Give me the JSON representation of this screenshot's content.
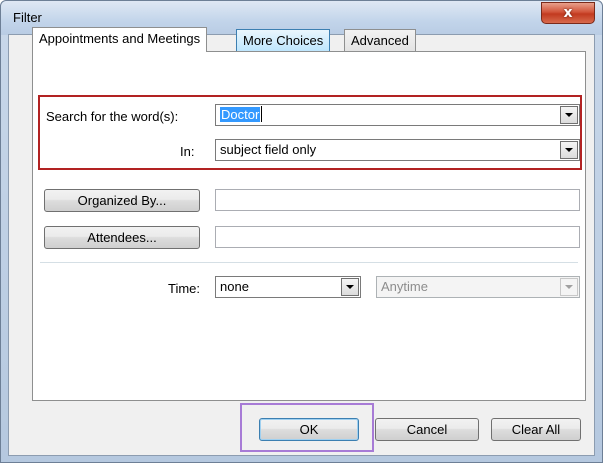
{
  "window": {
    "title": "Filter",
    "close_glyph": "x"
  },
  "tabs": [
    {
      "label": "Appointments and Meetings",
      "active": true
    },
    {
      "label": "More Choices",
      "active": false
    },
    {
      "label": "Advanced",
      "active": false
    }
  ],
  "search": {
    "label": "Search for the word(s):",
    "value": "Doctor",
    "in_label": "In:",
    "in_value": "subject field only"
  },
  "people": {
    "organized_by_label": "Organized By...",
    "organized_by_value": "",
    "attendees_label": "Attendees...",
    "attendees_value": ""
  },
  "time": {
    "label": "Time:",
    "value": "none",
    "range_value": "Anytime"
  },
  "buttons": {
    "ok": "OK",
    "cancel": "Cancel",
    "clear_all": "Clear All"
  },
  "colors": {
    "search_highlight": "#b22222",
    "ok_highlight": "#a77bd6",
    "selection": "#3399ff"
  },
  "icons": {
    "dropdown": "chevron-down-icon",
    "close": "close-icon"
  }
}
